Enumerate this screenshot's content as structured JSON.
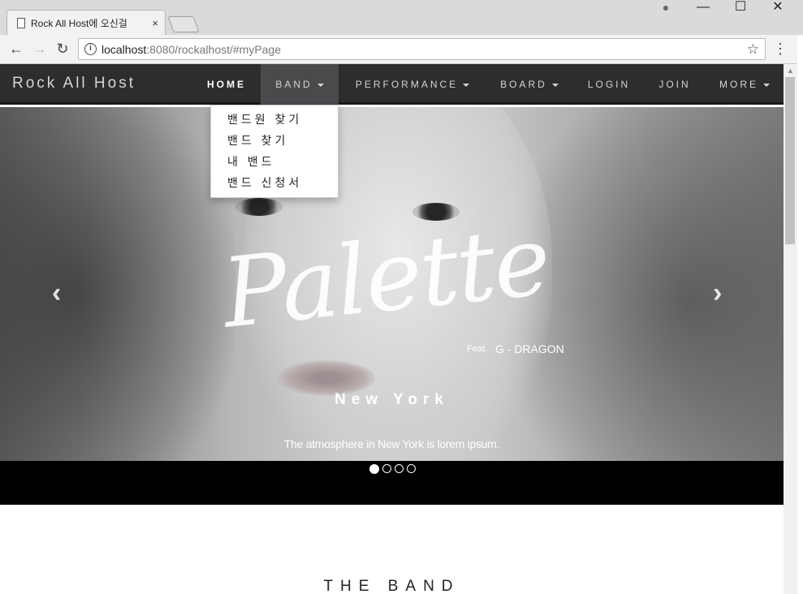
{
  "browser": {
    "tab_title": "Rock All Host에 오신걸",
    "tab_close": "×",
    "url_host": "localhost",
    "url_path": ":8080/rockalhost/#myPage",
    "back": "←",
    "forward": "→",
    "reload": "↻",
    "info": "i",
    "star": "☆",
    "menu": "⋮",
    "minimize": "—",
    "maximize": "☐",
    "close": "✕",
    "profile": "●"
  },
  "navbar": {
    "brand": "Rock All Host",
    "items": [
      {
        "label": "HOME"
      },
      {
        "label": "BAND"
      },
      {
        "label": "PERFORMANCE"
      },
      {
        "label": "BOARD"
      },
      {
        "label": "LOGIN"
      },
      {
        "label": "JOIN"
      },
      {
        "label": "MORE"
      }
    ]
  },
  "band_dropdown": {
    "items": [
      "밴드원 찾기",
      "밴드 찾기",
      "내 밴드",
      "밴드 신청서"
    ]
  },
  "carousel": {
    "script_title": "Palette",
    "feat_label": "Feat.",
    "feat_artist": "G - DRAGON",
    "caption_heading": "New York",
    "caption_text": "The atmosphere in New York is lorem ipsum.",
    "prev": "‹",
    "next": "›",
    "slide_count": 4,
    "active_slide": 1
  },
  "section": {
    "heading": "THE BAND"
  }
}
